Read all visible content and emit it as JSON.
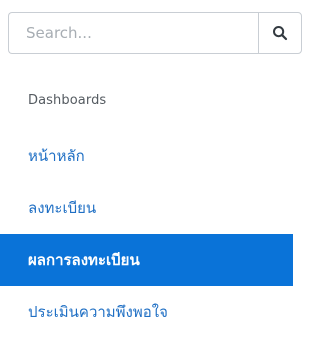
{
  "search": {
    "placeholder": "Search...",
    "value": ""
  },
  "sidebar": {
    "section_heading": "Dashboards",
    "items": [
      {
        "label": "หน้าหลัก",
        "active": false
      },
      {
        "label": "ลงทะเบียน",
        "active": false
      },
      {
        "label": "ผลการลงทะเบียน",
        "active": true
      },
      {
        "label": "ประเมินความพึงพอใจ",
        "active": false
      }
    ]
  },
  "colors": {
    "accent": "#0a73d8",
    "link": "#1f6fc4",
    "border": "#c9ced4"
  },
  "icons": {
    "search_button": "search-icon"
  }
}
